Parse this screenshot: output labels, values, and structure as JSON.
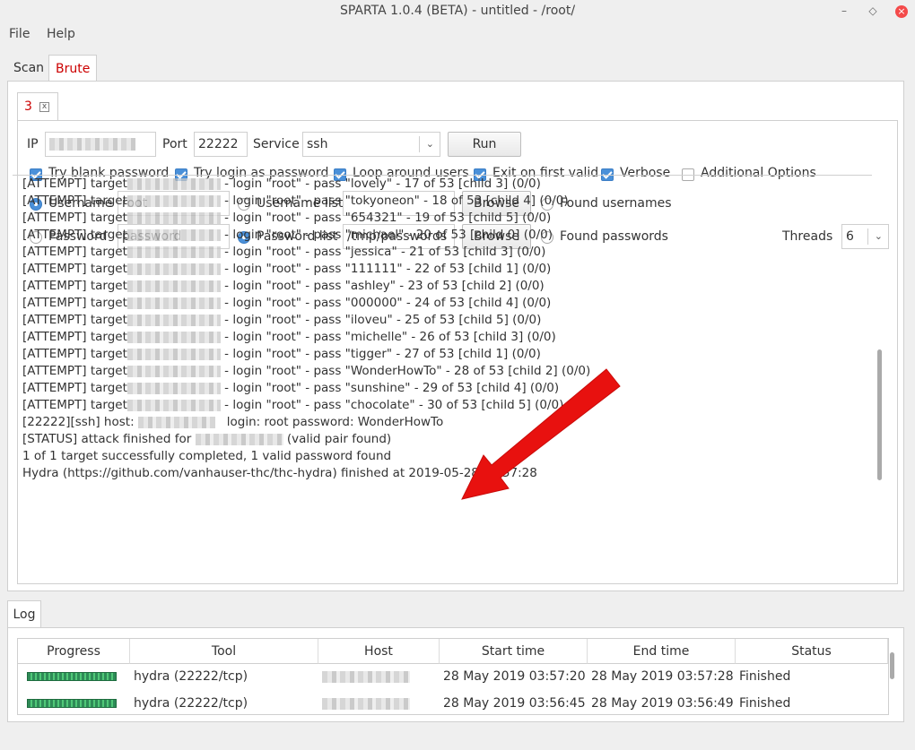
{
  "window": {
    "title": "SPARTA 1.0.4 (BETA) - untitled - /root/",
    "min_glyph": "–",
    "max_glyph": "◇",
    "close_glyph": "×"
  },
  "menu": {
    "file": "File",
    "help": "Help"
  },
  "tabs": {
    "scan": "Scan",
    "brute": "Brute"
  },
  "subtab": {
    "label": "3",
    "close_glyph": "x"
  },
  "form": {
    "ip_label": "IP",
    "port_label": "Port",
    "port_value": "22222",
    "service_label": "Service",
    "service_value": "ssh",
    "run_label": "Run",
    "try_blank_password": "Try blank password",
    "try_login_as_password": "Try login as password",
    "loop_around_users": "Loop around users",
    "exit_on_first_valid": "Exit on first valid",
    "verbose": "Verbose",
    "additional_options": "Additional Options",
    "username_label": "Username",
    "username_value": "root",
    "username_list_label": "Username list",
    "username_list_value": "",
    "browse_label": "Browse",
    "found_usernames": "Found usernames",
    "password_label": "Password",
    "password_value": "password",
    "password_list_label": "Password list",
    "password_list_value": "/tmp/passwords",
    "found_passwords": "Found passwords",
    "threads_label": "Threads",
    "threads_value": "6",
    "dropdown_glyph": "⌄"
  },
  "output": {
    "attempt_prefix": "[ATTEMPT] target",
    "attempts": [
      " - login \"root\" - pass \"lovely\" - 17 of 53 [child 3] (0/0)",
      " - login \"root\" - pass \"tokyoneon\" - 18 of 53 [child 4] (0/0)",
      " - login \"root\" - pass \"654321\" - 19 of 53 [child 5] (0/0)",
      " - login \"root\" - pass \"michael\" - 20 of 53 [child 0] (0/0)",
      " - login \"root\" - pass \"jessica\" - 21 of 53 [child 3] (0/0)",
      " - login \"root\" - pass \"111111\" - 22 of 53 [child 1] (0/0)",
      " - login \"root\" - pass \"ashley\" - 23 of 53 [child 2] (0/0)",
      " - login \"root\" - pass \"000000\" - 24 of 53 [child 4] (0/0)",
      " - login \"root\" - pass \"iloveu\" - 25 of 53 [child 5] (0/0)",
      " - login \"root\" - pass \"michelle\" - 26 of 53 [child 3] (0/0)",
      " - login \"root\" - pass \"tigger\" - 27 of 53 [child 1] (0/0)",
      " - login \"root\" - pass \"WonderHowTo\" - 28 of 53 [child 2] (0/0)",
      " - login \"root\" - pass \"sunshine\" - 29 of 53 [child 4] (0/0)",
      " - login \"root\" - pass \"chocolate\" - 30 of 53 [child 5] (0/0)"
    ],
    "found_prefix": "[22222][ssh] host:",
    "found_suffix": "login: root   password: WonderHowTo",
    "status_prefix": "[STATUS] attack finished for",
    "status_suffix": "(valid pair found)",
    "summary": "1 of 1 target successfully completed, 1 valid password found",
    "finished": "Hydra (https://github.com/vanhauser-thc/thc-hydra) finished at 2019-05-28 03:57:28"
  },
  "log": {
    "tab_label": "Log",
    "columns": [
      "Progress",
      "Tool",
      "Host",
      "Start time",
      "End time",
      "Status"
    ],
    "rows": [
      {
        "progress": 1.0,
        "tool": "hydra (22222/tcp)",
        "start": "28 May 2019 03:57:20",
        "end": "28 May 2019 03:57:28",
        "status": "Finished"
      },
      {
        "progress": 1.0,
        "tool": "hydra (22222/tcp)",
        "start": "28 May 2019 03:56:45",
        "end": "28 May 2019 03:56:49",
        "status": "Finished"
      }
    ]
  },
  "colors": {
    "accent": "#4a90d9",
    "active_tab_text": "#cc0000",
    "arrow": "#e8110f",
    "progress": "#2e8b57"
  }
}
